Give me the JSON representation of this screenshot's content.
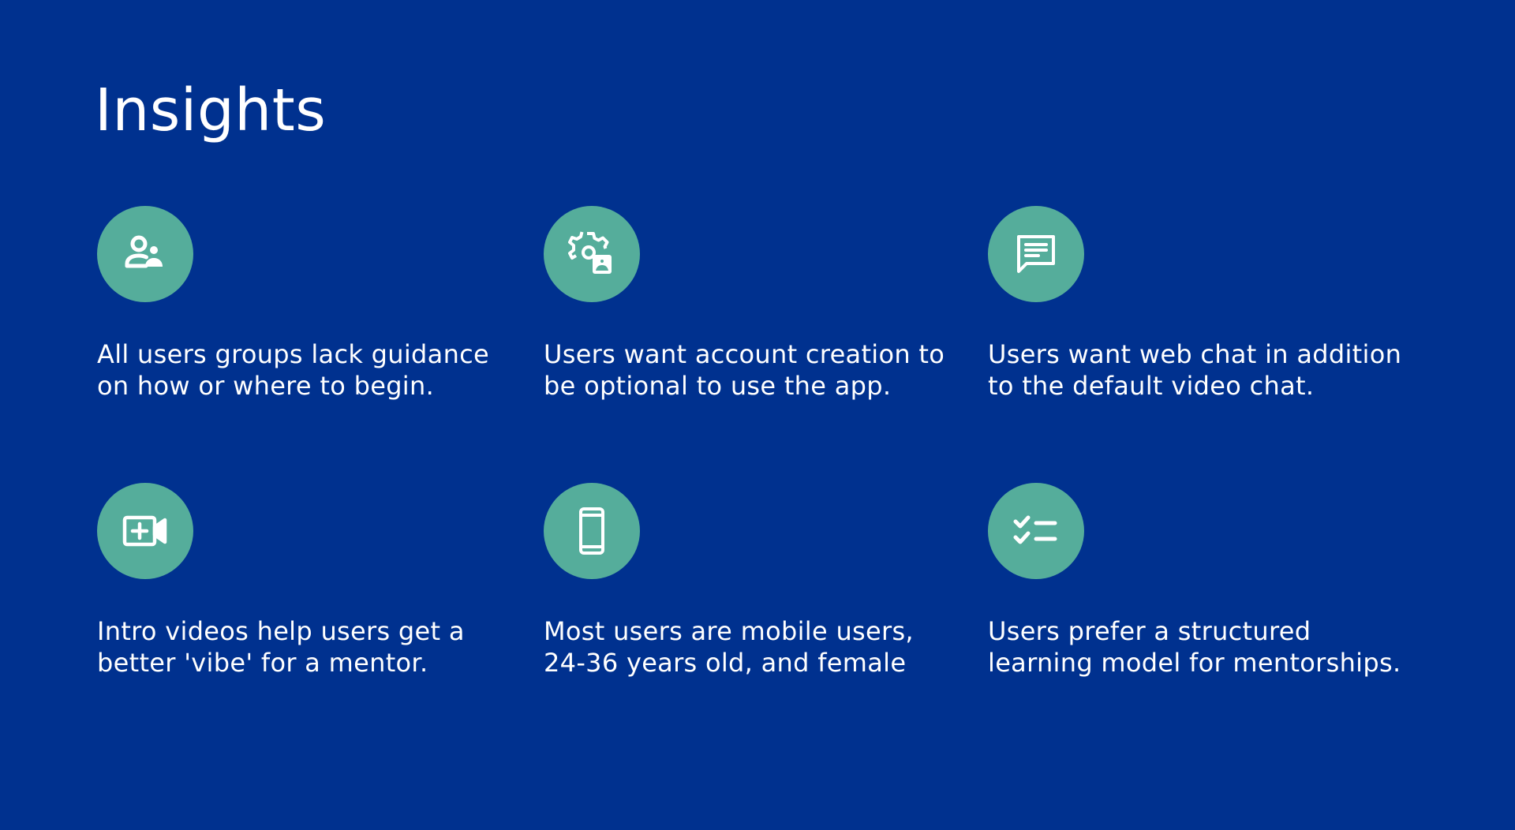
{
  "title": "Insights",
  "colors": {
    "background": "#00318f",
    "icon_circle": "#55ad9b",
    "text": "#ffffff"
  },
  "insights": [
    {
      "icon": "user-group-icon",
      "line1": "All users groups lack guidance",
      "line2": "on how or where to begin."
    },
    {
      "icon": "account-settings-icon",
      "line1": "Users want account creation to",
      "line2": "be optional to use the app."
    },
    {
      "icon": "chat-message-icon",
      "line1": "Users want web chat in addition",
      "line2": "to the default video chat."
    },
    {
      "icon": "video-call-icon",
      "line1": "Intro videos help users get a",
      "line2": "better 'vibe' for a mentor."
    },
    {
      "icon": "mobile-phone-icon",
      "line1": "Most users are mobile users,",
      "line2": "24-36 years old, and female"
    },
    {
      "icon": "checklist-icon",
      "line1": "Users prefer a structured",
      "line2": "learning model for mentorships."
    }
  ]
}
